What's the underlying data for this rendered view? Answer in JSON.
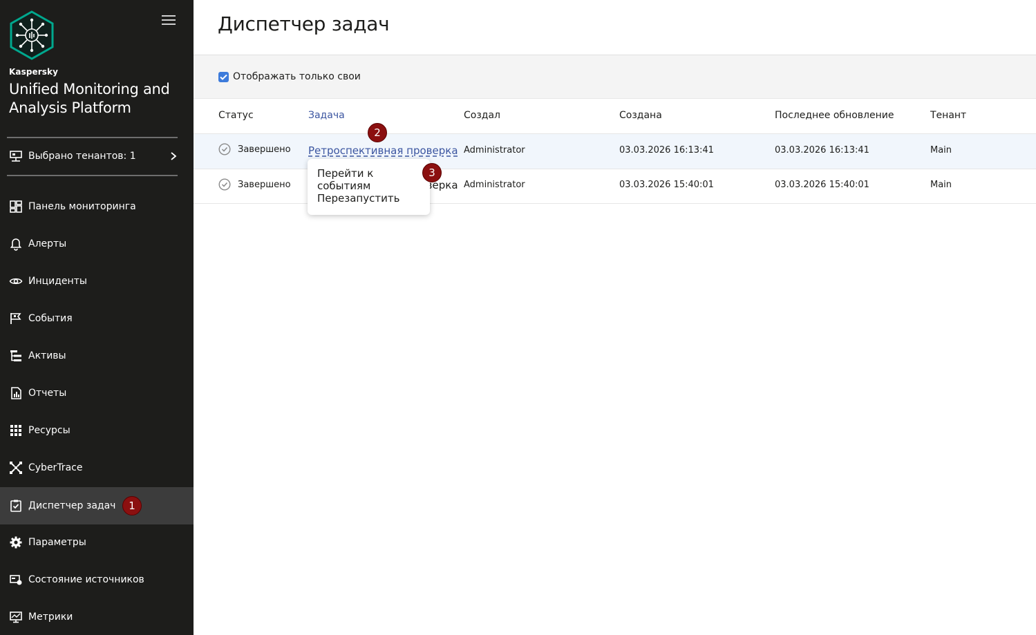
{
  "sidebar": {
    "brand": "Kaspersky",
    "product": "Unified Monitoring and Analysis Platform",
    "tenants_label": "Выбрано тенантов: 1",
    "items": [
      {
        "label": "Панель мониторинга",
        "icon": "dashboard-icon"
      },
      {
        "label": "Алерты",
        "icon": "bell-icon"
      },
      {
        "label": "Инциденты",
        "icon": "eye-icon"
      },
      {
        "label": "События",
        "icon": "flag-icon"
      },
      {
        "label": "Активы",
        "icon": "tree-icon"
      },
      {
        "label": "Отчеты",
        "icon": "report-icon"
      },
      {
        "label": "Ресурсы",
        "icon": "grid-icon"
      },
      {
        "label": "CyberTrace",
        "icon": "cybertrace-icon"
      },
      {
        "label": "Диспетчер задач",
        "icon": "clipboard-check-icon",
        "active": true
      },
      {
        "label": "Параметры",
        "icon": "gear-icon"
      },
      {
        "label": "Состояние источников",
        "icon": "source-status-icon"
      },
      {
        "label": "Метрики",
        "icon": "monitor-icon"
      }
    ]
  },
  "badges": [
    "1",
    "2",
    "3"
  ],
  "main": {
    "title": "Диспетчер задач",
    "filter_label": "Отображать только свои",
    "columns": [
      "Статус",
      "Задача",
      "Создал",
      "Создана",
      "Последнее обновление",
      "Тенант"
    ],
    "rows": [
      {
        "status": "Завершено",
        "task": "Ретроспективная проверка",
        "creator": "Administrator",
        "created": "03.03.2026 16:13:41",
        "updated": "03.03.2026 16:13:41",
        "tenant": "Main"
      },
      {
        "status": "Завершено",
        "task": "Ретроспективная проверка",
        "creator": "Administrator",
        "created": "03.03.2026 15:40:01",
        "updated": "03.03.2026 15:40:01",
        "tenant": "Main"
      }
    ],
    "context_menu": [
      "Перейти к событиям",
      "Перезапустить"
    ]
  },
  "colors": {
    "sidebar_bg": "#1d1d1b",
    "active_item_bg": "#3c3c3c",
    "link": "#3b55a0",
    "checkbox": "#3d7bdb",
    "badge": "#8b1010",
    "logo_accent": "#00a88e"
  }
}
